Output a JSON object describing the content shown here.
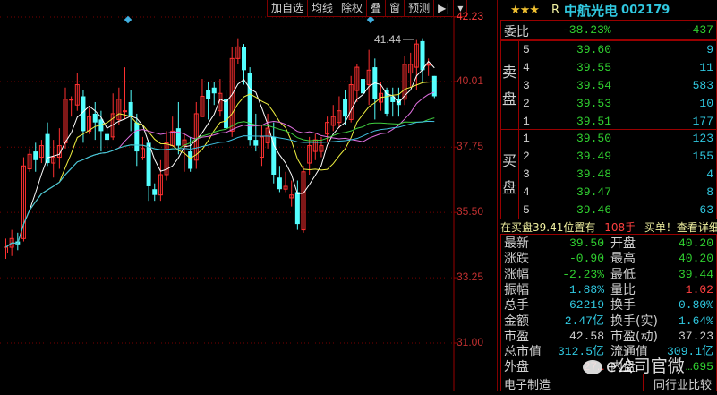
{
  "toolbar": [
    "加自选",
    "均线",
    "除权",
    "叠",
    "窗",
    "预测",
    "▶|",
    "▾"
  ],
  "axis": {
    "labels": [
      "42.23",
      "40.01",
      "37.75",
      "35.50",
      "33.25",
      "31.00"
    ],
    "values": [
      42.23,
      40.01,
      37.75,
      35.5,
      33.25,
      31.0
    ]
  },
  "chart_data": {
    "type": "candlestick",
    "high_marker": "41.44",
    "ylim": [
      31.0,
      42.23
    ],
    "ma_periods": [
      5,
      10,
      20,
      30,
      60
    ],
    "ma_colors": [
      "#ffffff",
      "#f0f040",
      "#e070e0",
      "#40d040",
      "#40c0e0"
    ],
    "up_color": "#ff3030",
    "down_color": "#54ffff",
    "ohlc": [
      [
        34.1,
        34.3,
        34.6,
        33.9
      ],
      [
        34.3,
        34.6,
        34.9,
        34.0
      ],
      [
        34.5,
        34.4,
        34.8,
        34.2
      ],
      [
        34.6,
        37.1,
        37.4,
        34.5
      ],
      [
        37.0,
        37.5,
        37.7,
        36.9
      ],
      [
        37.6,
        37.3,
        37.9,
        36.9
      ],
      [
        37.4,
        37.8,
        38.0,
        37.2
      ],
      [
        38.2,
        37.2,
        38.6,
        37.1
      ],
      [
        37.2,
        37.4,
        38.0,
        36.7
      ],
      [
        37.4,
        37.8,
        38.4,
        37.0
      ],
      [
        37.9,
        39.4,
        39.8,
        37.7
      ],
      [
        39.4,
        39.4,
        39.5,
        38.8
      ],
      [
        39.2,
        39.9,
        40.3,
        39.0
      ],
      [
        39.5,
        38.3,
        39.7,
        37.9
      ],
      [
        38.3,
        38.8,
        39.1,
        38.2
      ],
      [
        38.9,
        38.6,
        39.3,
        38.0
      ],
      [
        38.7,
        38.3,
        39.0,
        37.6
      ],
      [
        38.2,
        38.0,
        38.6,
        37.7
      ],
      [
        38.1,
        38.9,
        39.6,
        38.0
      ],
      [
        38.7,
        39.4,
        39.8,
        38.5
      ],
      [
        39.0,
        39.0,
        40.5,
        38.7
      ],
      [
        39.3,
        38.8,
        39.7,
        38.3
      ],
      [
        38.6,
        37.6,
        38.9,
        37.1
      ],
      [
        37.4,
        37.7,
        38.1,
        37.3
      ],
      [
        37.9,
        36.4,
        38.0,
        35.9
      ],
      [
        36.3,
        36.1,
        36.5,
        35.9
      ],
      [
        36.1,
        36.8,
        37.3,
        35.9
      ],
      [
        36.8,
        37.9,
        38.3,
        36.6
      ],
      [
        37.8,
        38.3,
        38.8,
        37.8
      ],
      [
        38.4,
        37.8,
        39.3,
        37.5
      ],
      [
        37.8,
        38.0,
        38.2,
        36.9
      ],
      [
        37.6,
        37.0,
        38.1,
        36.9
      ],
      [
        37.3,
        38.9,
        39.3,
        37.0
      ],
      [
        38.8,
        39.5,
        40.1,
        38.8
      ],
      [
        39.7,
        39.4,
        40.0,
        38.7
      ],
      [
        39.8,
        39.6,
        40.0,
        39.2
      ],
      [
        39.0,
        39.6,
        40.1,
        38.8
      ],
      [
        39.4,
        38.4,
        39.7,
        38.4
      ],
      [
        38.3,
        40.8,
        41.2,
        38.1
      ],
      [
        40.8,
        41.2,
        41.5,
        40.6
      ],
      [
        41.2,
        40.4,
        41.3,
        39.9
      ],
      [
        40.3,
        38.0,
        40.5,
        37.8
      ],
      [
        38.0,
        37.8,
        38.9,
        37.6
      ],
      [
        37.4,
        38.1,
        38.5,
        37.1
      ],
      [
        37.9,
        38.4,
        38.9,
        37.7
      ],
      [
        38.1,
        36.8,
        38.6,
        36.5
      ],
      [
        36.7,
        36.3,
        37.1,
        36.2
      ],
      [
        36.3,
        36.4,
        36.9,
        36.2
      ],
      [
        36.0,
        36.1,
        36.6,
        35.7
      ],
      [
        36.2,
        35.1,
        36.6,
        34.9
      ],
      [
        34.9,
        36.9,
        37.1,
        34.8
      ],
      [
        37.2,
        37.8,
        38.1,
        36.8
      ],
      [
        37.6,
        38.0,
        38.2,
        37.3
      ],
      [
        37.6,
        37.8,
        38.1,
        37.4
      ],
      [
        38.2,
        38.6,
        38.8,
        37.9
      ],
      [
        38.5,
        38.8,
        39.2,
        38.3
      ],
      [
        38.6,
        39.0,
        39.5,
        38.4
      ],
      [
        39.4,
        38.8,
        39.7,
        38.5
      ],
      [
        38.7,
        39.9,
        40.2,
        38.6
      ],
      [
        39.7,
        40.5,
        40.6,
        39.3
      ],
      [
        40.1,
        39.6,
        40.2,
        39.4
      ],
      [
        39.9,
        40.4,
        41.1,
        39.2
      ],
      [
        40.5,
        39.4,
        40.8,
        38.7
      ],
      [
        39.3,
        39.6,
        40.0,
        39.0
      ],
      [
        39.7,
        38.9,
        39.8,
        38.8
      ],
      [
        39.5,
        39.3,
        39.8,
        38.8
      ],
      [
        39.4,
        39.2,
        39.8,
        38.8
      ],
      [
        39.4,
        40.6,
        40.9,
        39.2
      ],
      [
        40.3,
        40.6,
        41.0,
        39.8
      ],
      [
        40.5,
        41.3,
        41.44,
        39.7
      ],
      [
        41.4,
        40.4,
        41.5,
        40.0
      ],
      [
        40.6,
        40.6,
        40.8,
        40.2
      ],
      [
        40.2,
        39.5,
        40.2,
        39.44
      ]
    ]
  },
  "panel": {
    "rating": "★★★",
    "flag": "R",
    "name": "中航光电",
    "code": "002179",
    "weibi_label": "委比",
    "weibi_pct": "-38.23%",
    "weibi_diff": "-437",
    "sell_label": [
      "卖",
      "盘"
    ],
    "buy_label": [
      "买",
      "盘"
    ],
    "sell": [
      {
        "n": "5",
        "p": "39.60",
        "v": "9"
      },
      {
        "n": "4",
        "p": "39.55",
        "v": "11"
      },
      {
        "n": "3",
        "p": "39.54",
        "v": "583"
      },
      {
        "n": "2",
        "p": "39.53",
        "v": "10"
      },
      {
        "n": "1",
        "p": "39.51",
        "v": "177"
      }
    ],
    "buy": [
      {
        "n": "1",
        "p": "39.50",
        "v": "123"
      },
      {
        "n": "2",
        "p": "39.49",
        "v": "155"
      },
      {
        "n": "3",
        "p": "39.48",
        "v": "4"
      },
      {
        "n": "4",
        "p": "39.47",
        "v": "8"
      },
      {
        "n": "5",
        "p": "39.46",
        "v": "63"
      }
    ],
    "notice": {
      "a": "在买盘39.41位置有",
      "b": "108手",
      "c": "买单！查看详细"
    },
    "stats": [
      {
        "l": "最新",
        "v": "39.50",
        "vc": "g",
        "l2": "开盘",
        "v2": "40.20",
        "v2c": "g"
      },
      {
        "l": "涨跌",
        "v": "-0.90",
        "vc": "g",
        "l2": "最高",
        "v2": "40.20",
        "v2c": "g"
      },
      {
        "l": "涨幅",
        "v": "-2.23%",
        "vc": "g",
        "l2": "最低",
        "v2": "39.44",
        "v2c": "g"
      },
      {
        "l": "振幅",
        "v": "1.88%",
        "vc": "c",
        "l2": "量比",
        "v2": "1.02",
        "v2c": "r"
      },
      {
        "l": "总手",
        "v": "62219",
        "vc": "c",
        "l2": "换手",
        "v2": "0.80%",
        "v2c": "c"
      },
      {
        "l": "金额",
        "v": "2.47亿",
        "vc": "c",
        "l2": "换手(实)",
        "v2": "1.64%",
        "v2c": "c"
      },
      {
        "l": "市盈",
        "v": "42.58",
        "vc": "w",
        "l2": "市盈(动)",
        "v2": "37.23",
        "v2c": "w"
      },
      {
        "l": "总市值",
        "v": "312.5亿",
        "vc": "c",
        "l2": "流通值",
        "v2": "309.1亿",
        "v2c": "c"
      },
      {
        "l": "外盘",
        "v": "27…",
        "vc": "r",
        "l2": "内盘",
        "v2": "…695",
        "v2c": "g"
      }
    ],
    "footer": {
      "industry": "电子制造",
      "dash": "–",
      "compare": "同行业比较"
    },
    "watermark": "e公司官微"
  }
}
